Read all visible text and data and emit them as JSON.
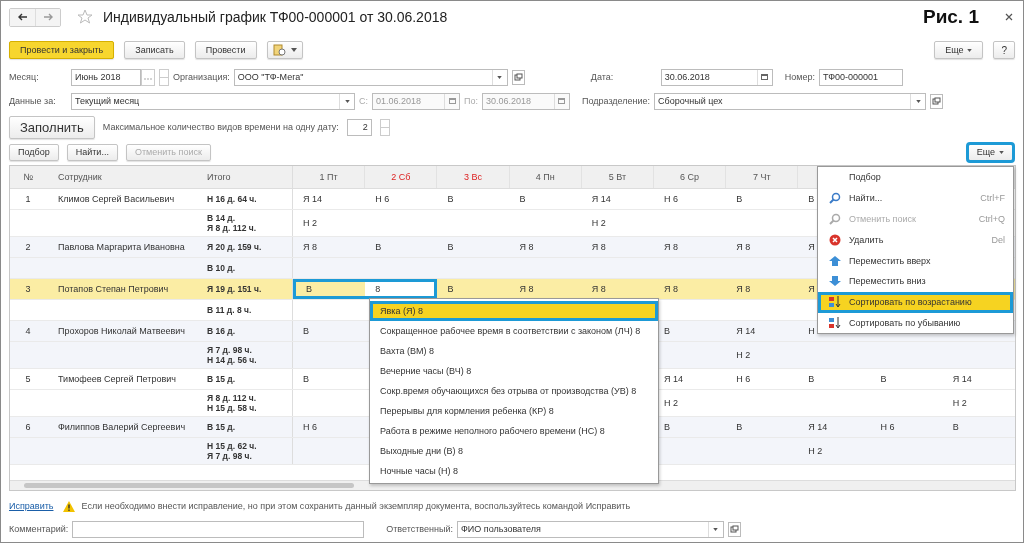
{
  "window": {
    "title": "Индивидуальный график ТФ00-000001 от 30.06.2018",
    "figure_label": "Рис. 1"
  },
  "toolbar": {
    "buttons": [
      {
        "label": "Провести и закрыть",
        "kind": "primary"
      },
      {
        "label": "Записать",
        "kind": "normal"
      },
      {
        "label": "Провести",
        "kind": "normal"
      }
    ],
    "more": "Еще",
    "help": "?"
  },
  "fields": {
    "month": {
      "label": "Месяц:",
      "value": "Июнь 2018"
    },
    "organization": {
      "label": "Организация:",
      "value": "ООО \"ТФ-Мега\""
    },
    "date": {
      "label": "Дата:",
      "value": "30.06.2018"
    },
    "number": {
      "label": "Номер:",
      "value": "ТФ00-000001"
    },
    "period": {
      "label": "Данные за:",
      "value": "Текущий месяц"
    },
    "from": {
      "label": "С:",
      "value": "01.06.2018",
      "disabled": true
    },
    "to": {
      "label": "По:",
      "value": "30.06.2018",
      "disabled": true
    },
    "department": {
      "label": "Подразделение:",
      "value": "Сборочный цех"
    }
  },
  "fill": {
    "button": "Заполнить",
    "max_label": "Максимальное количество видов времени на одну дату:",
    "max_value": "2"
  },
  "table_toolbar": {
    "buttons": [
      {
        "label": "Подбор",
        "disabled": false
      },
      {
        "label": "Найти...",
        "disabled": false
      },
      {
        "label": "Отменить поиск",
        "disabled": true
      }
    ],
    "more": {
      "label": "Еще",
      "highlighted": true
    }
  },
  "table": {
    "columns": [
      "№",
      "Сотрудник",
      "Итого"
    ],
    "days": [
      {
        "label": "1 Пт",
        "weekend": false
      },
      {
        "label": "2 Сб",
        "weekend": true
      },
      {
        "label": "3 Вс",
        "weekend": true
      },
      {
        "label": "4 Пн",
        "weekend": false
      },
      {
        "label": "5 Вт",
        "weekend": false
      },
      {
        "label": "6 Ср",
        "weekend": false
      },
      {
        "label": "7 Чт",
        "weekend": false
      }
    ],
    "rows": [
      {
        "number": "1",
        "name": "Климов Сергей Васильевич",
        "selected": false,
        "totals": [
          [
            "Н 16 д. 64 ч."
          ],
          [
            "В 14 д.",
            "Я 8 д. 112 ч."
          ]
        ],
        "days": [
          {
            "d1": "Я 14",
            "d2": "Н 6",
            "d3": "В",
            "d4": "В",
            "d5": "Я 14",
            "d6": "Н 6",
            "d7": "В",
            "d8": "В"
          },
          {
            "d1": "Н 2",
            "d5": "Н 2"
          }
        ]
      },
      {
        "number": "2",
        "name": "Павлова Маргарита Ивановна",
        "selected": false,
        "totals": [
          [
            "Я 20 д. 159 ч."
          ],
          [
            "В 10 д."
          ]
        ],
        "days": [
          {
            "d1": "Я 8",
            "d2": "В",
            "d3": "В",
            "d4": "Я 8",
            "d5": "Я 8",
            "d6": "Я 8",
            "d7": "Я 8",
            "d8": "Я"
          }
        ]
      },
      {
        "number": "3",
        "name": "Потапов Степан Петрович",
        "selected": true,
        "totals": [
          [
            "Я 19 д. 151 ч."
          ],
          [
            "В 11 д. 8 ч."
          ]
        ],
        "days": [
          {
            "d1": "В",
            "d2": "8",
            "d3": "В",
            "d4": "Я 8",
            "d5": "Я 8",
            "d6": "Я 8",
            "d7": "Я 8",
            "d8": "Я"
          }
        ]
      },
      {
        "number": "4",
        "name": "Прохоров Николай Матвеевич",
        "selected": false,
        "totals": [
          [
            "В 16 д."
          ],
          [
            "Я 7 д. 98 ч.",
            "Н 14 д. 56 ч."
          ]
        ],
        "days": [
          {
            "d1": "В",
            "d6": "В",
            "d7": "Я 14",
            "d8": "Н"
          },
          {
            "d7": "Н 2"
          }
        ]
      },
      {
        "number": "5",
        "name": "Тимофеев Сергей Петрович",
        "selected": false,
        "totals": [
          [
            "В 15 д."
          ],
          [
            "Я 8 д. 112 ч.",
            "Н 15 д. 58 ч."
          ]
        ],
        "days": [
          {
            "d1": "В",
            "d6": "Я 14",
            "d7": "Н 6",
            "d8": "В",
            "d9": "В",
            "d10": "Я 14"
          },
          {
            "d6": "Н 2",
            "d10": "Н 2"
          }
        ]
      },
      {
        "number": "6",
        "name": "Филиппов Валерий Сергеевич",
        "selected": false,
        "totals": [
          [
            "В 15 д."
          ],
          [
            "Н 15 д. 62 ч.",
            "Я 7 д. 98 ч."
          ]
        ],
        "days": [
          {
            "d1": "Н 6",
            "d6": "В",
            "d7": "В",
            "d8": "Я 14",
            "d9": "Н 6",
            "d10": "В"
          },
          {
            "d8": "Н 2"
          }
        ]
      }
    ]
  },
  "value_popup": {
    "items": [
      {
        "label": "Явка (Я) 8",
        "selected": true
      },
      {
        "label": "Сокращенное рабочее время в соответствии с законом (ЛЧ) 8",
        "selected": false
      },
      {
        "label": "Вахта (ВМ) 8",
        "selected": false
      },
      {
        "label": "Вечерние часы (ВЧ) 8",
        "selected": false
      },
      {
        "label": "Сокр.время обучающихся без отрыва от производства (УВ) 8",
        "selected": false
      },
      {
        "label": "Перерывы для кормления ребенка (КР) 8",
        "selected": false
      },
      {
        "label": "Работа в режиме неполного рабочего времени (НС) 8",
        "selected": false
      },
      {
        "label": "Выходные дни (В) 8",
        "selected": false
      },
      {
        "label": "Ночные часы (Н) 8",
        "selected": false
      }
    ]
  },
  "context_menu": {
    "items": [
      {
        "label": "Подбор",
        "disabled": false,
        "selected": false
      },
      {
        "label": "Найти...",
        "shortcut": "Ctrl+F",
        "disabled": false,
        "selected": false
      },
      {
        "label": "Отменить поиск",
        "shortcut": "Ctrl+Q",
        "disabled": true,
        "selected": false
      },
      {
        "label": "Удалить",
        "shortcut": "Del",
        "disabled": false,
        "selected": false
      },
      {
        "label": "Переместить вверх",
        "disabled": false,
        "selected": false
      },
      {
        "label": "Переместить вниз",
        "disabled": false,
        "selected": false
      },
      {
        "label": "Сортировать по возрастанию",
        "disabled": false,
        "selected": true
      },
      {
        "label": "Сортировать по убыванию",
        "disabled": false,
        "selected": false
      }
    ]
  },
  "footer": {
    "fix_link": "Исправить",
    "fix_message": "Если необходимо внести исправление, но при этом сохранить данный экземпляр документа, воспользуйтесь командой Исправить",
    "comment_label": "Комментарий:",
    "responsible_label": "Ответственный:",
    "responsible_value": "ФИО пользователя"
  }
}
